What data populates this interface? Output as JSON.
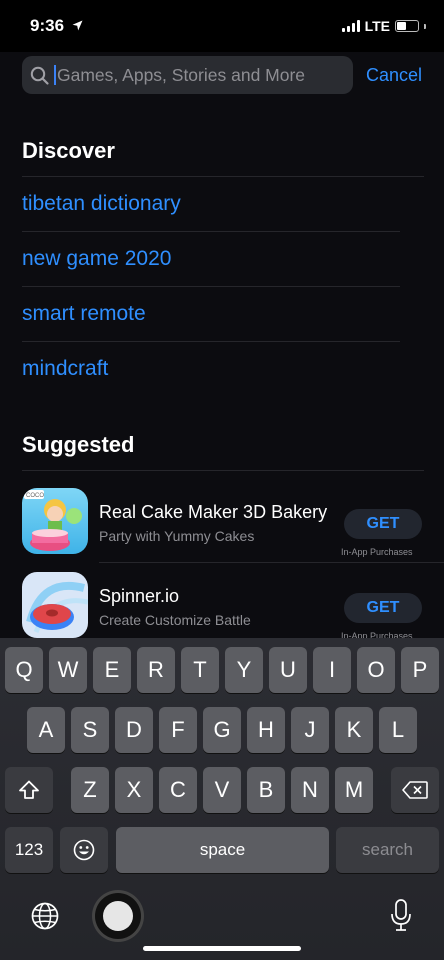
{
  "status_bar": {
    "time": "9:36",
    "network": "LTE",
    "battery_level": 0.45
  },
  "search": {
    "placeholder": "Games, Apps, Stories and More",
    "value": "",
    "cancel_label": "Cancel"
  },
  "discover": {
    "title": "Discover",
    "items": [
      "tibetan dictionary",
      "new game 2020",
      "smart remote",
      "mindcraft"
    ]
  },
  "suggested": {
    "title": "Suggested",
    "apps": [
      {
        "name": "Real Cake Maker 3D Bakery",
        "subtitle": "Party with Yummy Cakes",
        "button": "GET",
        "note": "In-App Purchases",
        "icon": "cake-maker-app-icon",
        "icon_logo_text": "COCO"
      },
      {
        "name": "Spinner.io",
        "subtitle": "Create Customize Battle",
        "button": "GET",
        "note": "In-App Purchases",
        "icon": "spinner-app-icon"
      }
    ]
  },
  "keyboard": {
    "row1": [
      "Q",
      "W",
      "E",
      "R",
      "T",
      "Y",
      "U",
      "I",
      "O",
      "P"
    ],
    "row2": [
      "A",
      "S",
      "D",
      "F",
      "G",
      "H",
      "J",
      "K",
      "L"
    ],
    "row3": [
      "Z",
      "X",
      "C",
      "V",
      "B",
      "N",
      "M"
    ],
    "numbers_label": "123",
    "space_label": "space",
    "search_label": "search"
  },
  "colors": {
    "accent": "#2f8fff",
    "background": "#0c0c10",
    "key": "#5c5d62"
  }
}
